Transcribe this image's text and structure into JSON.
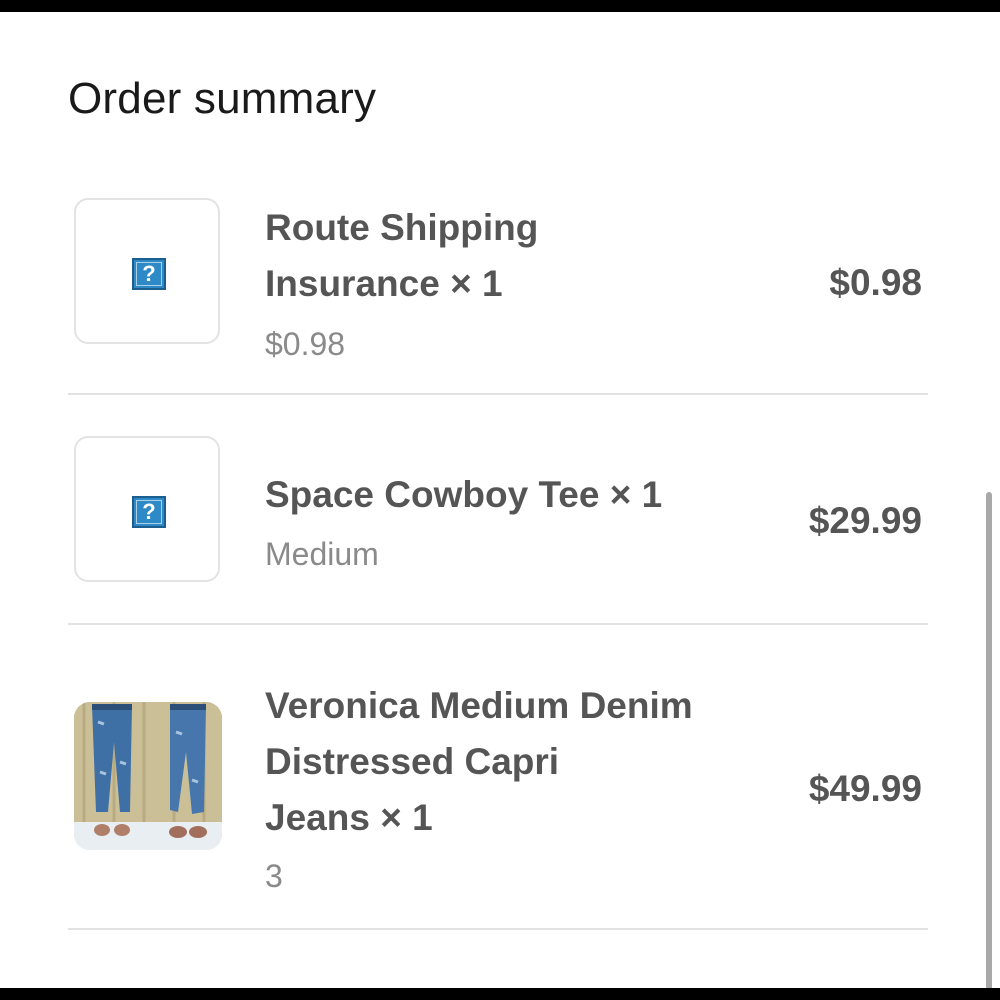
{
  "header": {
    "title": "Order summary"
  },
  "items": [
    {
      "name_line1": "Route Shipping",
      "name_line2": "Insurance × 1",
      "subtitle": "$0.98",
      "price": "$0.98",
      "thumbnail": "placeholder-question-icon"
    },
    {
      "name_line1": "Space Cowboy Tee × 1",
      "subtitle": "Medium",
      "price": "$29.99",
      "thumbnail": "placeholder-question-icon"
    },
    {
      "name_line1": "Veronica Medium Denim",
      "name_line2": "Distressed Capri",
      "name_line3": "Jeans × 1",
      "subtitle": "3",
      "price": "$49.99",
      "thumbnail": "jeans-photo"
    }
  ],
  "placeholder_icon_glyph": "?",
  "colors": {
    "placeholder_icon": "#2d8ac7",
    "text_primary": "#555555",
    "text_secondary": "#8a8a8a"
  }
}
